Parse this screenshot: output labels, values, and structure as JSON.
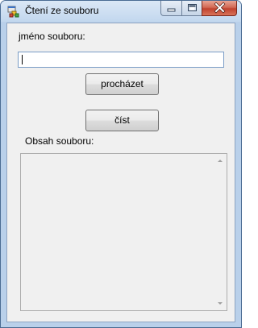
{
  "window": {
    "title": "Čtení ze souboru",
    "controls": [
      "minimize-icon",
      "maximize-icon",
      "close-icon"
    ]
  },
  "form": {
    "file_label": "jméno souboru:",
    "file_input_value": "",
    "browse_button": "procházet",
    "read_button": "číst",
    "content_label": "Obsah souboru:",
    "content_value": ""
  },
  "colors": {
    "title_gradient_top": "#dbe8f6",
    "client_bg": "#f0f0f0",
    "close_red": "#c0422e"
  }
}
